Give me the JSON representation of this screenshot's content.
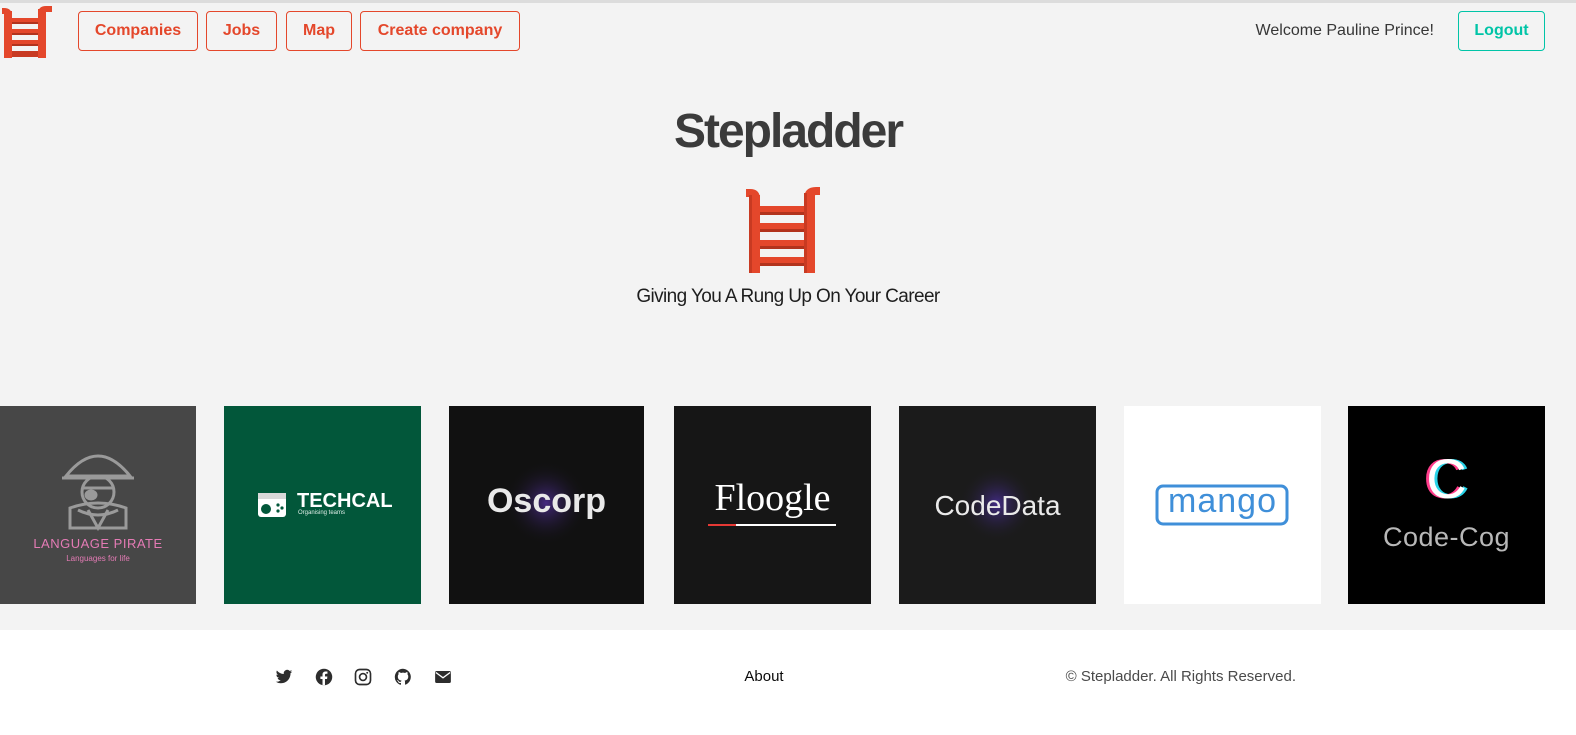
{
  "brand": {
    "accent": "#e4472b",
    "secondary": "#00c4a7"
  },
  "nav": {
    "logo_icon": "ladder-icon",
    "companies": "Companies",
    "jobs": "Jobs",
    "map": "Map",
    "create_company": "Create company",
    "welcome": "Welcome Pauline Prince!",
    "logout": "Logout"
  },
  "hero": {
    "title": "Stepladder",
    "icon": "ladder-icon",
    "subtitle": "Giving You A Rung Up On Your Career"
  },
  "companies": [
    {
      "name": "LANGUAGE PIRATE",
      "tagline": "Languages for life",
      "bg": "#474747",
      "text_color": "#e47bb5"
    },
    {
      "name": "TECHCAL",
      "tagline": "Organising teams",
      "bg": "#02573a",
      "text_color": "#ffffff"
    },
    {
      "name": "Oscorp",
      "bg": "#111111",
      "text_color": "#e9e9e9"
    },
    {
      "name": "Floogle",
      "bg": "#161616",
      "text_color": "#ffffff",
      "underline_color": "#e53935"
    },
    {
      "name": "CodeData",
      "bg": "#1b1b1b",
      "text_color": "#eaeaea"
    },
    {
      "name": "mango",
      "bg": "#ffffff",
      "text_color": "#3f8fd9"
    },
    {
      "name": "Code-Cog",
      "logo_letter": "C",
      "bg": "#000000",
      "text_color": "#b8b8b8"
    }
  ],
  "footer": {
    "social": [
      "twitter-icon",
      "facebook-icon",
      "instagram-icon",
      "github-icon",
      "envelope-icon"
    ],
    "about": "About",
    "copyright": "© Stepladder. All Rights Reserved."
  }
}
